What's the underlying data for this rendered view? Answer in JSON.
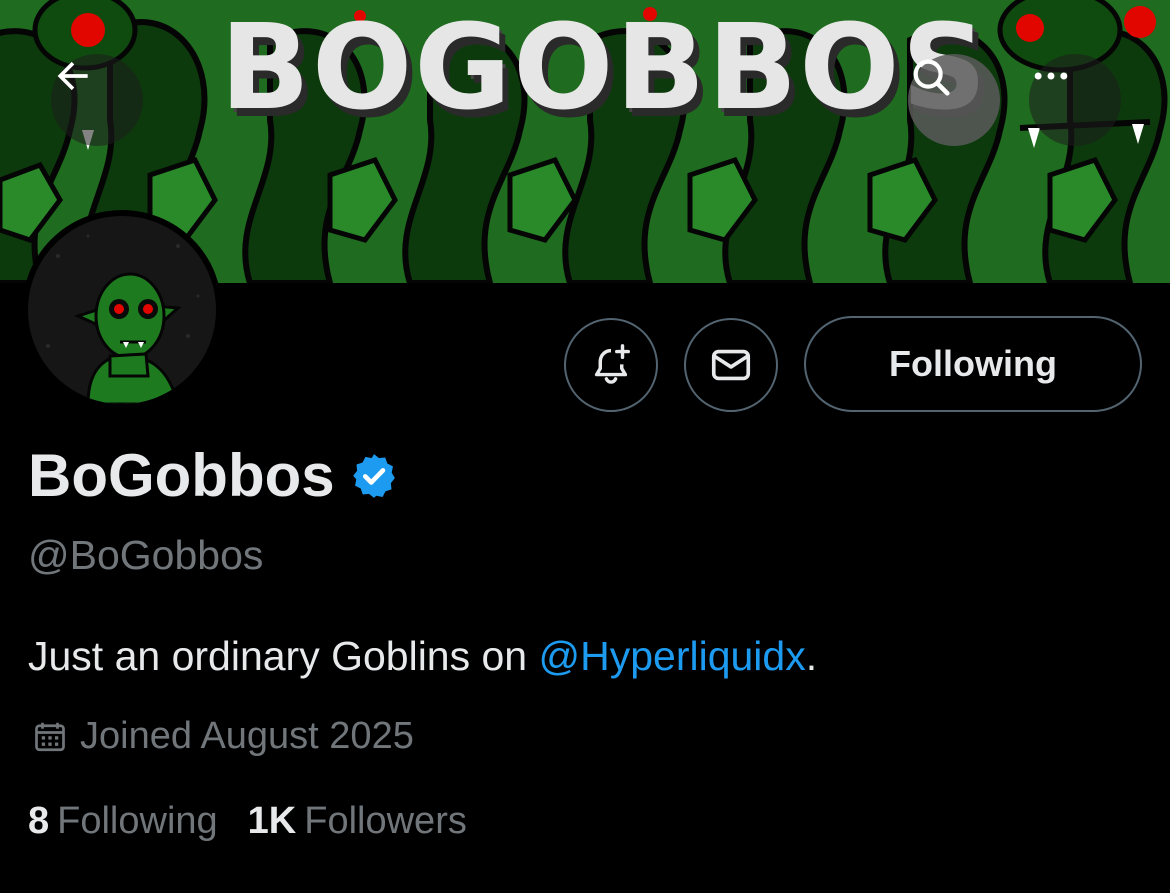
{
  "banner": {
    "title": "BOGOBBOS"
  },
  "header": {
    "back_icon": "arrow-left-icon",
    "search_icon": "search-icon",
    "more_icon": "more-horizontal-icon"
  },
  "profile": {
    "display_name": "BoGobbos",
    "verified_icon": "verified-badge-icon",
    "handle": "@BoGobbos",
    "bio_text": "Just an ordinary Goblins on ",
    "bio_mention": "@Hyperliquidx",
    "bio_end": ".",
    "joined": "Joined August 2025",
    "following_count": "8",
    "following_label": "Following",
    "followers_count": "1K",
    "followers_label": "Followers"
  },
  "actions": {
    "notify_icon": "bell-plus-icon",
    "message_icon": "envelope-icon",
    "follow_state_label": "Following"
  },
  "colors": {
    "background": "#000000",
    "text_primary": "#e7e9ea",
    "text_secondary": "#71767b",
    "link": "#1d9bf0",
    "verified": "#1d9bf0",
    "border": "#536471",
    "banner_green": "#1f6b1f"
  }
}
